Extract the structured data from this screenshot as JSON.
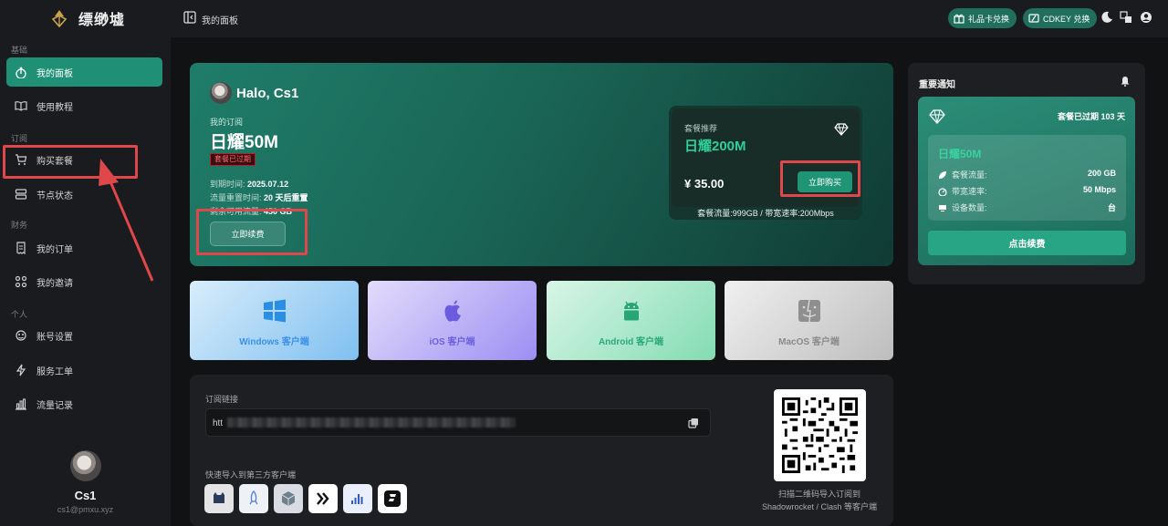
{
  "brand": {
    "name": "缥缈墟"
  },
  "sidebar": {
    "sections": {
      "basic": "基础",
      "subscribe": "订阅",
      "finance": "财务",
      "personal": "个人"
    },
    "items": [
      {
        "label": "我的面板",
        "icon": "gauge-icon"
      },
      {
        "label": "使用教程",
        "icon": "book-icon"
      },
      {
        "label": "购买套餐",
        "icon": "cart-icon"
      },
      {
        "label": "节点状态",
        "icon": "server-icon"
      },
      {
        "label": "我的订单",
        "icon": "receipt-icon"
      },
      {
        "label": "我的邀请",
        "icon": "share-icon"
      },
      {
        "label": "账号设置",
        "icon": "user-gear-icon"
      },
      {
        "label": "服务工单",
        "icon": "bolt-icon"
      },
      {
        "label": "流量记录",
        "icon": "bar-chart-icon"
      }
    ]
  },
  "profile": {
    "username": "Cs1",
    "email": "cs1@pmxu.xyz"
  },
  "header": {
    "title": "我的面板",
    "gift_card": "礼品卡兑换",
    "cdkey": "CDKEY 兑换"
  },
  "hero": {
    "greeting": "Halo, Cs1",
    "my_sub_label": "我的订阅",
    "plan_name": "日耀50M",
    "status_badge": "套餐已过期",
    "expire_label": "到期时间:",
    "expire_value": "2025.07.12",
    "reset_label": "流量重置时间:",
    "reset_value": "20 天后重置",
    "remaining_label": "剩余可用流量:",
    "remaining_value": "450 GB",
    "renew_button": "立即续费"
  },
  "recommend": {
    "label": "套餐推荐",
    "plan": "日耀200M",
    "price": "¥ 35.00",
    "buy_button": "立即购买",
    "spec": "套餐流量:999GB / 带宽速率:200Mbps"
  },
  "clients": [
    {
      "label": "Windows 客户端",
      "color": "#3a90e8"
    },
    {
      "label": "iOS 客户端",
      "color": "#7b6be6"
    },
    {
      "label": "Android 客户端",
      "color": "#2aa978"
    },
    {
      "label": "MacOS 客户端",
      "color": "#8a8a8a"
    }
  ],
  "subscription": {
    "link_label": "订阅链接",
    "link_prefix": "htt",
    "import_label": "快速导入到第三方客户端",
    "qr_caption_1": "扫描二维码导入订阅到",
    "qr_caption_2": "Shadowrocket / Clash 等客户端"
  },
  "notice": {
    "title": "重要通知",
    "expired_text": "套餐已过期 103 天",
    "plan_name": "日耀50M",
    "rows": [
      {
        "label": "套餐流量:",
        "value": "200 GB"
      },
      {
        "label": "带宽速率:",
        "value": "50 Mbps"
      },
      {
        "label": "设备数量:",
        "value": "台"
      }
    ],
    "renew_button": "点击续费"
  },
  "colors": {
    "accent": "#1f8f75",
    "highlight": "#e0474a"
  }
}
